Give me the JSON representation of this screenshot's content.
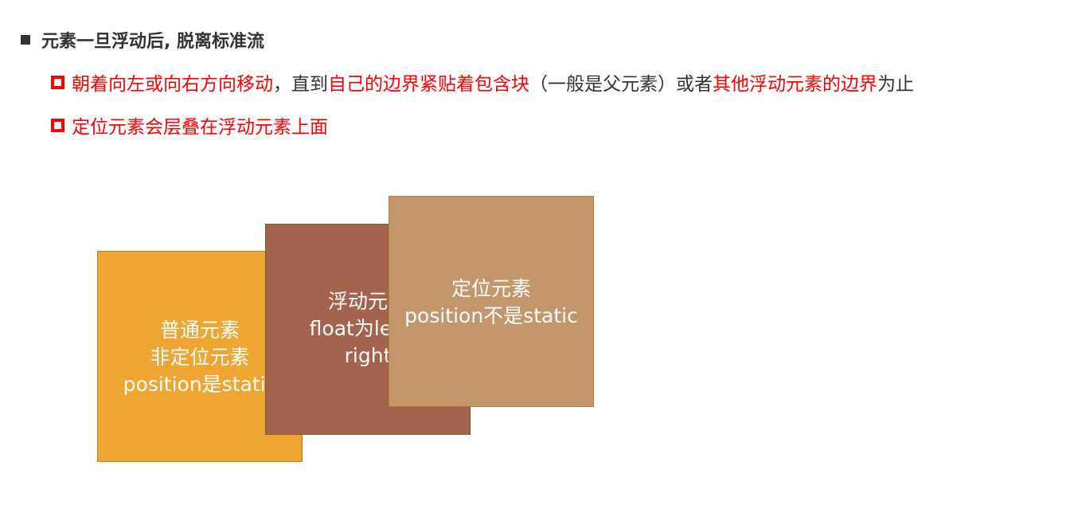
{
  "heading": {
    "text": "元素一旦浮动后, 脱离标准流"
  },
  "bullets": [
    {
      "segments": [
        {
          "text": "朝着向左或向右方向移动",
          "color": "#ff0000"
        },
        {
          "text": "，直到",
          "color": "#333333"
        },
        {
          "text": "自己的边界紧贴着包含块",
          "color": "#ff0000"
        },
        {
          "text": "（一般是父元素）或者",
          "color": "#333333"
        },
        {
          "text": "其他浮动元素的边界",
          "color": "#ff0000"
        },
        {
          "text": "为止",
          "color": "#333333"
        }
      ]
    },
    {
      "text": "定位元素会层叠在浮动元素上面",
      "color": "#ff0000"
    }
  ],
  "boxes": {
    "normal": {
      "lines": [
        "普通元素",
        "非定位元素",
        "position是static"
      ],
      "color": "#eea532"
    },
    "float": {
      "lines": [
        "浮动元素",
        "float为left或",
        "right"
      ],
      "color": "#a4634c"
    },
    "positioned": {
      "lines": [
        "定位元素",
        "position不是static"
      ],
      "color": "#c4976b"
    }
  }
}
